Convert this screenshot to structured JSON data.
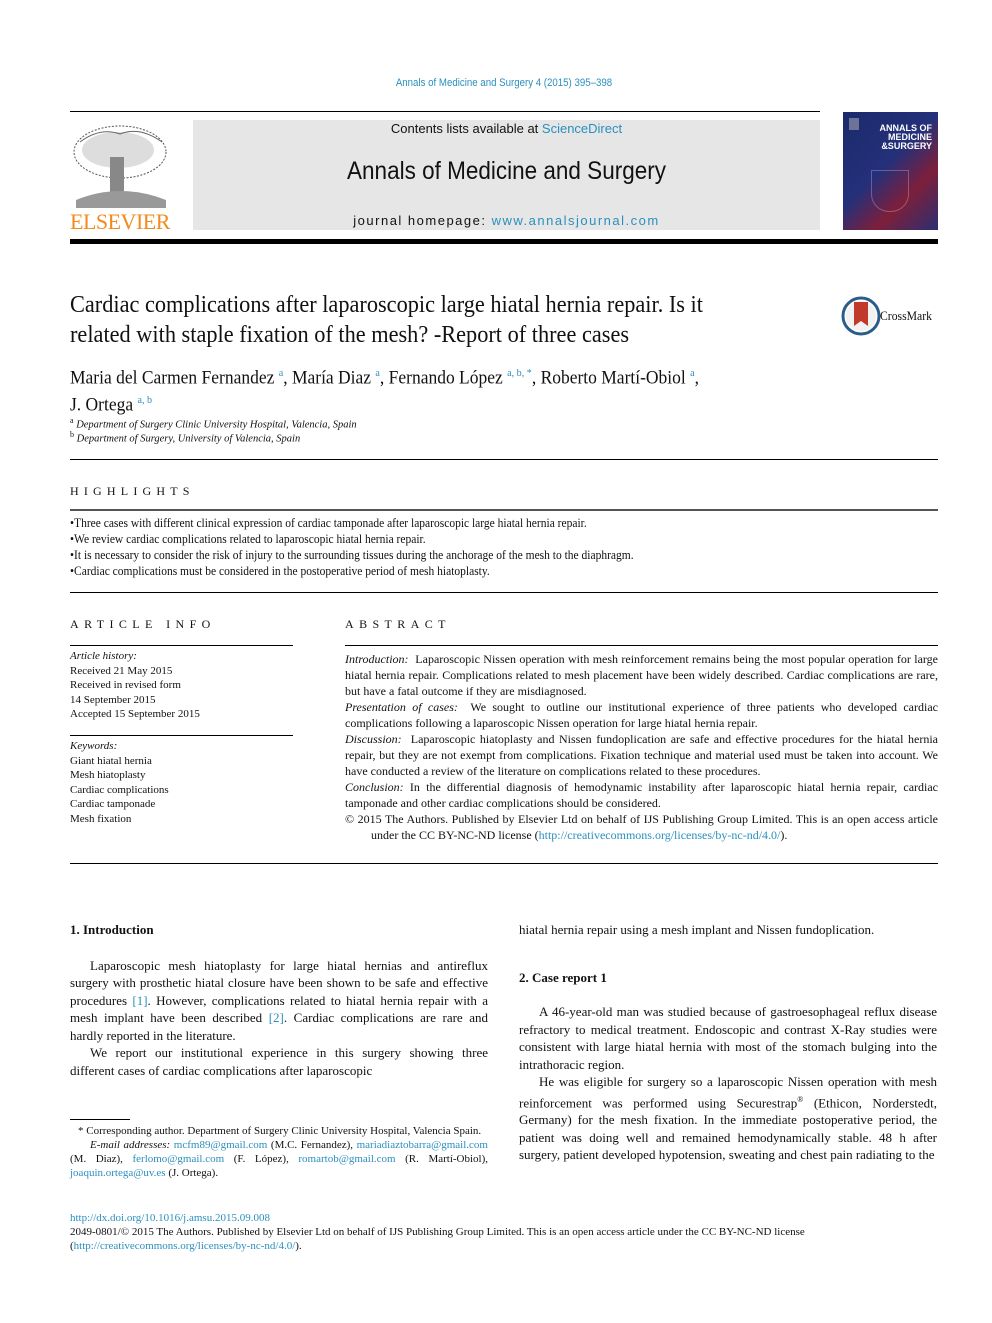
{
  "header": {
    "citation": "Annals of Medicine and Surgery 4 (2015) 395–398",
    "contents_prefix": "Contents lists available at ",
    "contents_link": "ScienceDirect",
    "journal_name": "Annals of Medicine and Surgery",
    "homepage_prefix": "journal homepage: ",
    "homepage_link": "www.annalsjournal.com",
    "publisher": "ELSEVIER",
    "cover_title_1": "ANNALS OF",
    "cover_title_2": "MEDICINE",
    "cover_title_3": "&SURGERY",
    "crossmark_label": "CrossMark"
  },
  "article": {
    "title": "Cardiac complications after laparoscopic large hiatal hernia repair. Is it related with staple fixation of the mesh? -Report of three cases",
    "title_line1": "Cardiac complications after laparoscopic large hiatal hernia repair. Is it",
    "title_line2": "related with staple fixation of the mesh? -Report of three cases",
    "authors": [
      {
        "name": "Maria del Carmen Fernandez",
        "sup": "a"
      },
      {
        "name": "María Diaz",
        "sup": "a"
      },
      {
        "name": "Fernando López",
        "sup": "a, b, *"
      },
      {
        "name": "Roberto Martí-Obiol",
        "sup": "a"
      },
      {
        "name": "J. Ortega",
        "sup": "a, b"
      }
    ],
    "affiliations": [
      {
        "sup": "a",
        "text": "Department of Surgery Clinic University Hospital, Valencia, Spain"
      },
      {
        "sup": "b",
        "text": "Department of Surgery, University of Valencia, Spain"
      }
    ]
  },
  "highlights": {
    "heading": "HIGHLIGHTS",
    "items": [
      "Three cases with different clinical expression of cardiac tamponade after laparoscopic large hiatal hernia repair.",
      "We review cardiac complications related to laparoscopic hiatal hernia repair.",
      "It is necessary to consider the risk of injury to the surrounding tissues during the anchorage of the mesh to the diaphragm.",
      "Cardiac complications must be considered in the postoperative period of mesh hiatoplasty."
    ]
  },
  "article_info": {
    "heading": "ARTICLE INFO",
    "history_label": "Article history:",
    "history": [
      "Received 21 May 2015",
      "Received in revised form",
      "14 September 2015",
      "Accepted 15 September 2015"
    ],
    "keywords_label": "Keywords:",
    "keywords": [
      "Giant hiatal hernia",
      "Mesh hiatoplasty",
      "Cardiac complications",
      "Cardiac tamponade",
      "Mesh fixation"
    ]
  },
  "abstract": {
    "heading": "ABSTRACT",
    "sections": [
      {
        "label": "Introduction:",
        "text": "Laparoscopic Nissen operation with mesh reinforcement remains being the most popular operation for large hiatal hernia repair. Complications related to mesh placement have been widely described. Cardiac complications are rare, but have a fatal outcome if they are misdiagnosed."
      },
      {
        "label": "Presentation of cases:",
        "text": "We sought to outline our institutional experience of three patients who developed cardiac complications following a laparoscopic Nissen operation for large hiatal hernia repair."
      },
      {
        "label": "Discussion:",
        "text": "Laparoscopic hiatoplasty and Nissen fundoplication are safe and effective procedures for the hiatal hernia repair, but they are not exempt from complications. Fixation technique and material used must be taken into account. We have conducted a review of the literature on complications related to these procedures."
      },
      {
        "label": "Conclusion:",
        "text": "In the differential diagnosis of hemodynamic instability after laparoscopic hiatal hernia repair, cardiac tamponade and other cardiac complications should be considered."
      }
    ],
    "copyright": "© 2015 The Authors. Published by Elsevier Ltd on behalf of IJS Publishing Group Limited. This is an open access article under the CC BY-NC-ND license (",
    "license_link": "http://creativecommons.org/licenses/by-nc-nd/4.0/",
    "copyright_end": ")."
  },
  "body": {
    "intro_heading": "1.  Introduction",
    "intro_p1_a": "Laparoscopic mesh hiatoplasty for large hiatal hernias and antireflux surgery with prosthetic hiatal closure have been shown to be safe and effective procedures ",
    "ref1": "[1]",
    "intro_p1_b": ". However, complications related to hiatal hernia repair with a mesh implant have been described ",
    "ref2": "[2]",
    "intro_p1_c": ". Cardiac complications are rare and hardly reported in the literature.",
    "intro_p2": "We report our institutional experience in this surgery showing three different cases of cardiac complications after laparoscopic",
    "col2_cont": "hiatal hernia repair using a mesh implant and Nissen fundoplication.",
    "case1_heading": "2.  Case report 1",
    "case1_p1": "A 46-year-old man was studied because of gastroesophageal reflux disease refractory to medical treatment. Endoscopic and contrast X-Ray studies were consistent with large hiatal hernia with most of the stomach bulging into the intrathoracic region.",
    "case1_p2_a": "He was eligible for surgery so a laparoscopic Nissen operation with mesh reinforcement was performed using Securestrap",
    "case1_p2_reg": "®",
    "case1_p2_b": " (Ethicon, Norderstedt, Germany) for the mesh fixation. In the im­mediate postoperative period, the patient was doing well and remained hemodynamically stable. 48 h after surgery, patient developed hypotension, sweating and chest pain radiating to the"
  },
  "footnotes": {
    "corresponding": "* Corresponding author. Department of Surgery Clinic University Hospital, Valencia Spain.",
    "email_label": "E-mail addresses:",
    "emails": [
      {
        "email": "mcfm89@gmail.com",
        "who": " (M.C. Fernandez), "
      },
      {
        "email": "mariadiaztobarra@gmail.com",
        "who": " (M. Diaz), "
      },
      {
        "email": "ferlomo@gmail.com",
        "who": " (F. López), "
      },
      {
        "email": "romartob@gmail.com",
        "who": " (R. Martí-Obiol), "
      },
      {
        "email": "joaquin.ortega@uv.es",
        "who": " (J. Ortega)."
      }
    ]
  },
  "footer": {
    "doi": "http://dx.doi.org/10.1016/j.amsu.2015.09.008",
    "issn_text": "2049-0801/© 2015 The Authors. Published by Elsevier Ltd on behalf of IJS Publishing Group Limited. This is an open access article under the CC BY-NC-ND license (",
    "license_link": "http://creativecommons.org/licenses/by-nc-nd/4.0/",
    "end": ")."
  },
  "colors": {
    "link": "#2a8fbd",
    "elsevier_orange": "#f28a1e",
    "masthead_bg": "#e6e6e6"
  }
}
